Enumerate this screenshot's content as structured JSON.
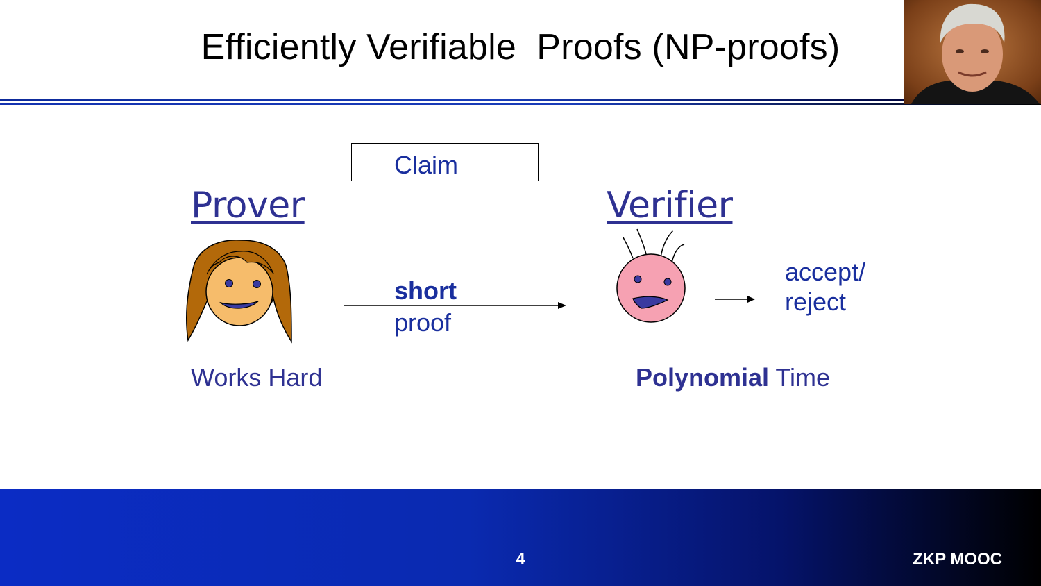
{
  "slide": {
    "title": "Efficiently Verifiable  Proofs (NP-proofs)",
    "claim": "Claim",
    "prover": {
      "label": "Prover",
      "caption": "Works Hard"
    },
    "verifier": {
      "label": "Verifier",
      "caption_bold": "Polynomial",
      "caption_rest": " Time"
    },
    "message": {
      "bold": "short",
      "rest": "proof"
    },
    "result": {
      "line1": "accept/",
      "line2": "reject"
    }
  },
  "footer": {
    "page_number": "4",
    "brand": "ZKP MOOC"
  },
  "colors": {
    "accent": "#2e3192",
    "footer_start": "#0b2cc4",
    "footer_end": "#000000"
  },
  "icons": [
    "prover-face-icon",
    "verifier-face-icon",
    "presenter-photo"
  ]
}
